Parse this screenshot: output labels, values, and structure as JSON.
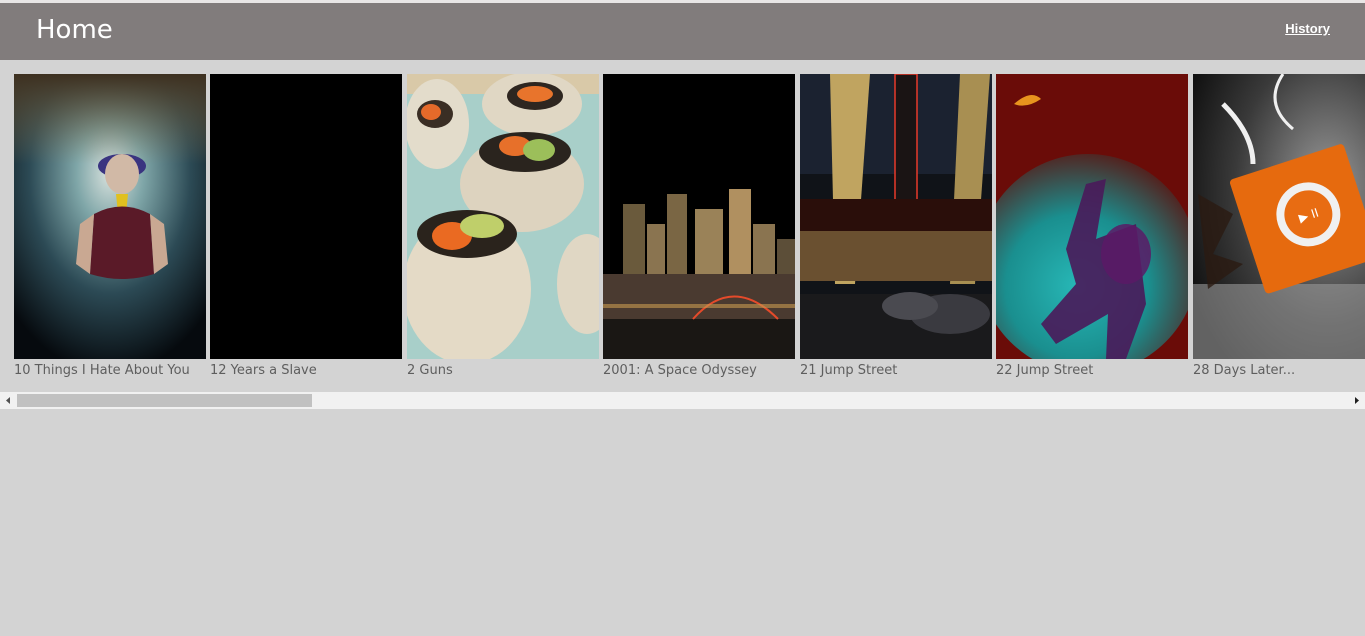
{
  "header": {
    "title": "Home",
    "history_link": "History"
  },
  "movies": [
    {
      "title": "10 Things I Hate About You",
      "poster": "underwater-swimmer-photo"
    },
    {
      "title": "12 Years a Slave",
      "poster": "black-empty-poster"
    },
    {
      "title": "2 Guns",
      "poster": "sushi-rolls-photo"
    },
    {
      "title": "2001: A Space Odyssey",
      "poster": "night-city-skyline-photo"
    },
    {
      "title": "21 Jump Street",
      "poster": "cinema-neon-sign-photo"
    },
    {
      "title": "22 Jump Street",
      "poster": "dancer-silhouette-photo"
    },
    {
      "title": "28 Days Later...",
      "poster": "orange-music-player-photo"
    }
  ],
  "scrollbar": {
    "orientation": "horizontal"
  }
}
